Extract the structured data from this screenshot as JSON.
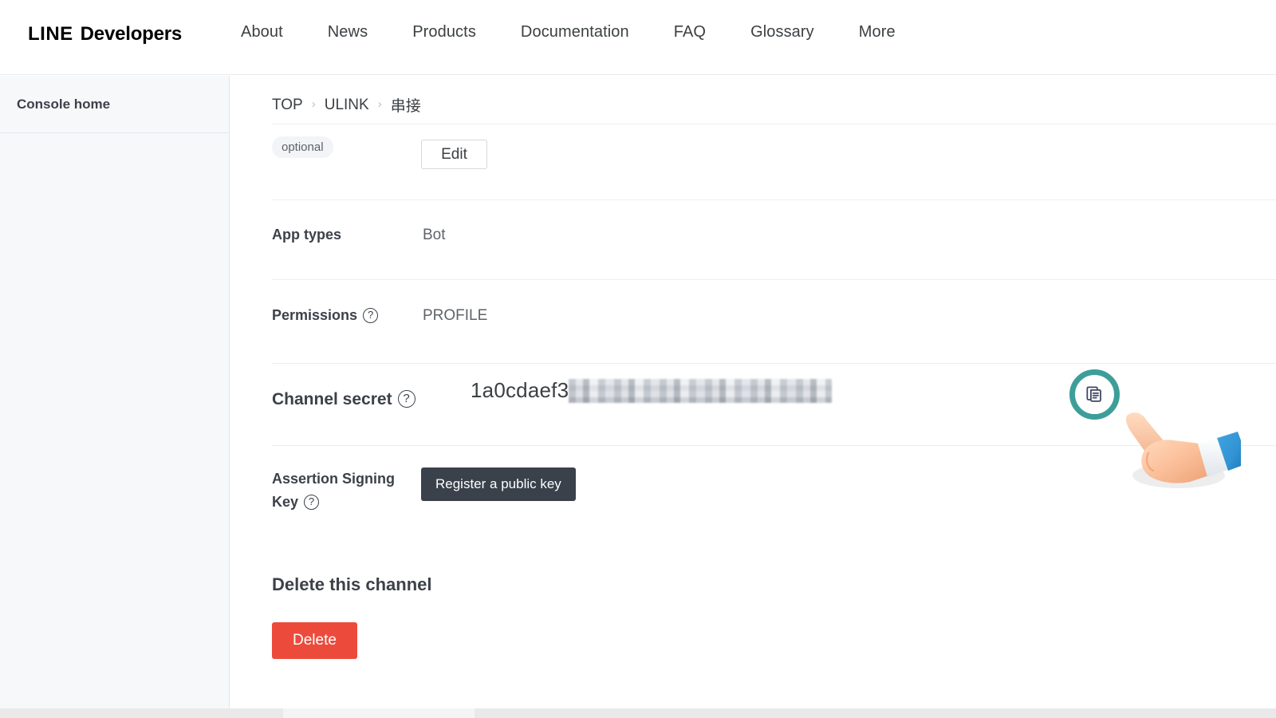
{
  "header": {
    "brand_line": "LINE",
    "brand_developers": "Developers",
    "nav": [
      {
        "label": "About"
      },
      {
        "label": "News"
      },
      {
        "label": "Products"
      },
      {
        "label": "Documentation"
      },
      {
        "label": "FAQ"
      },
      {
        "label": "Glossary"
      },
      {
        "label": "More"
      }
    ]
  },
  "sidebar": {
    "console_home": "Console home"
  },
  "breadcrumb": {
    "items": [
      {
        "label": "TOP"
      },
      {
        "label": "ULINK"
      },
      {
        "label": "串接"
      }
    ],
    "separator": "›"
  },
  "form": {
    "optional_badge": "optional",
    "edit_button": "Edit",
    "app_types": {
      "label": "App types",
      "value": "Bot"
    },
    "permissions": {
      "label": "Permissions",
      "value": "PROFILE",
      "help_icon": "question-mark-circle-icon",
      "help_glyph": "?"
    },
    "channel_secret": {
      "label": "Channel secret",
      "value_visible": "1a0cdaef3",
      "value_redacted": true,
      "help_glyph": "?",
      "copy_icon": "copy-icon"
    },
    "assertion_signing_key": {
      "label_line1": "Assertion Signing",
      "label_line2": "Key",
      "help_glyph": "?",
      "button": "Register a public key"
    }
  },
  "delete_section": {
    "title": "Delete this channel",
    "button": "Delete"
  },
  "colors": {
    "accent_teal": "#3d9e99",
    "danger_red": "#ec4b3c",
    "dark_button": "#3a414b",
    "sidebar_bg": "#f7f8fa",
    "text_primary": "#3c4149",
    "text_secondary": "#5f6368"
  }
}
